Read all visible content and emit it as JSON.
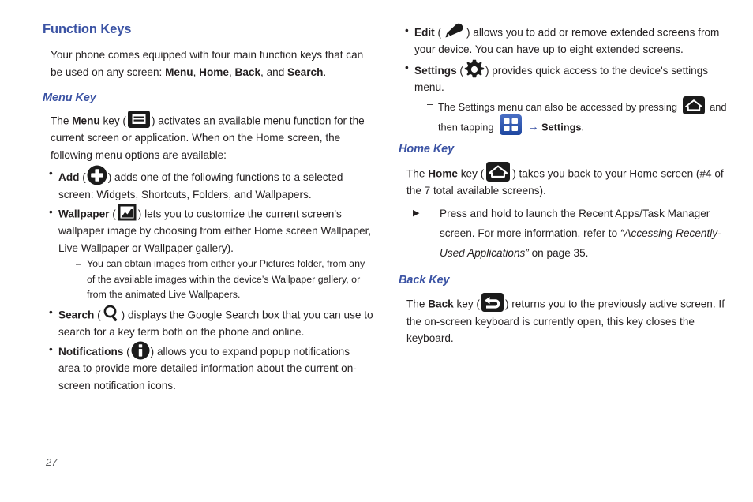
{
  "page": {
    "number": "27",
    "background": "#ffffff",
    "heading_color": "#3b53a4",
    "text_color": "#231f20"
  },
  "left_column": {
    "section_title": "Function Keys",
    "intro": {
      "part1": "Your phone comes equipped with four main function keys that can be used on any screen: ",
      "key1": "Menu",
      "sep1": ", ",
      "key2": "Home",
      "sep2": ", ",
      "key3": "Back",
      "sep3": ", and ",
      "key4": "Search",
      "end": "."
    },
    "menu_key": {
      "title": "Menu Key",
      "para_pre": "The ",
      "para_bold": "Menu",
      "para_mid": " key (",
      "para_post": ") activates an available menu function for the current screen or application. When on the Home screen, the following menu options are available:",
      "options": [
        {
          "label": "Add",
          "pre": " (",
          "post": ") adds one of the following functions to a selected screen: Widgets, Shortcuts, Folders, and Wallpapers.",
          "icon": "add-circle-icon"
        },
        {
          "label": "Wallpaper",
          "pre": " (",
          "post": ") lets you to customize the current screen's wallpaper image by choosing from either Home screen Wallpaper, Live Wallpaper or Wallpaper gallery).",
          "icon": "wallpaper-icon",
          "subnotes": [
            "You can obtain images from either your Pictures folder, from any of the available images within the device’s Wallpaper gallery, or from the animated Live Wallpapers."
          ]
        },
        {
          "label": "Search",
          "pre": " (",
          "post": ") displays the Google Search box that you can use to search for a key term both on the phone and online.",
          "icon": "search-icon"
        },
        {
          "label": "Notifications",
          "pre": " (",
          "post": ") allows you to expand popup notifications area to provide more detailed information about the current on-screen notification icons.",
          "icon": "notifications-icon"
        }
      ]
    }
  },
  "right_column": {
    "options": [
      {
        "label": "Edit",
        "pre": " (",
        "post": ") allows you to add or remove extended screens from your device. You can have up to eight extended screens.",
        "icon": "edit-pencil-icon"
      },
      {
        "label": "Settings",
        "pre": " (",
        "post": ") provides quick access to the device's settings menu.",
        "icon": "gear-icon",
        "subnotes": [
          {
            "pre": "The Settings menu can also be accessed by pressing ",
            "mid": " and then tapping ",
            "arrow": "→",
            "bold": "Settings",
            "end": ".",
            "icon1": "home-key-icon",
            "icon2": "apps-grid-icon"
          }
        ]
      }
    ],
    "home_key": {
      "title": "Home Key",
      "para_pre": "The ",
      "para_bold": "Home",
      "para_mid": " key (",
      "para_post": ") takes you back to your Home screen (#4 of the 7 total available screens).",
      "bullet": {
        "pre": "Press and hold to launch the Recent Apps/Task Manager screen. For more information, refer to ",
        "italic": "“Accessing Recently-Used Applications”",
        "post": " on page 35."
      }
    },
    "back_key": {
      "title": "Back Key",
      "para_pre": "The ",
      "para_bold": "Back",
      "para_mid": " key (",
      "para_post": ") returns you to the previously active screen. If the on-screen keyboard is currently open, this key closes the keyboard."
    }
  }
}
